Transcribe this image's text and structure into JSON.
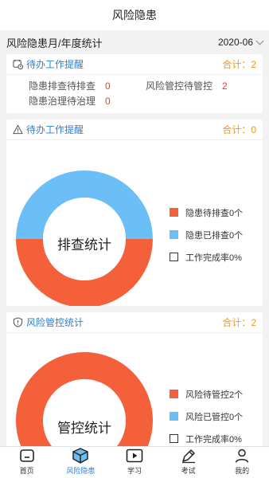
{
  "page": {
    "title": "风险隐患"
  },
  "subheader": {
    "title": "风险隐患月/年度统计",
    "date": "2020-06"
  },
  "todo_card": {
    "title": "待办工作提醒",
    "total_label": "合计：2",
    "items": [
      {
        "label": "隐患排查待排查",
        "value": "0"
      },
      {
        "label": "风险管控待管控",
        "value": "2"
      },
      {
        "label": "隐患治理待治理",
        "value": "0"
      }
    ]
  },
  "inspection_card": {
    "title": "待办工作提醒",
    "total_label": "合计：0",
    "center_label": "排查统计",
    "legend": [
      {
        "label": "隐患待排查0个",
        "color": "#f4603a"
      },
      {
        "label": "隐患已排查0个",
        "color": "#6bbff6"
      },
      {
        "label": "工作完成率0%",
        "color": "#ffffff"
      }
    ]
  },
  "control_card": {
    "title": "风险管控统计",
    "total_label": "合计：2",
    "center_label": "管控统计",
    "legend": [
      {
        "label": "风险待管控2个",
        "color": "#f4603a"
      },
      {
        "label": "风险已管控0个",
        "color": "#6bbff6"
      },
      {
        "label": "工作完成率0%",
        "color": "#ffffff"
      }
    ]
  },
  "chart_data": [
    {
      "type": "pie",
      "categories": [
        "隐患待排查",
        "隐患已排查"
      ],
      "values": [
        0,
        0
      ],
      "display_shares": [
        0.5,
        0.5
      ],
      "colors": [
        "#f4603a",
        "#6bbff6"
      ]
    },
    {
      "type": "pie",
      "categories": [
        "风险待管控",
        "风险已管控"
      ],
      "values": [
        2,
        0
      ],
      "colors": [
        "#f4603a",
        "#6bbff6"
      ]
    }
  ],
  "tabbar": {
    "active": "风险隐患",
    "tabs": [
      {
        "label": "首页",
        "icon": "home-icon"
      },
      {
        "label": "风险隐患",
        "icon": "cube-icon"
      },
      {
        "label": "学习",
        "icon": "play-icon"
      },
      {
        "label": "考试",
        "icon": "pen-icon"
      },
      {
        "label": "我的",
        "icon": "user-icon"
      }
    ]
  },
  "colors": {
    "accent": "#2d7fd3",
    "orange": "#f19a1e",
    "danger": "#e5402a"
  }
}
